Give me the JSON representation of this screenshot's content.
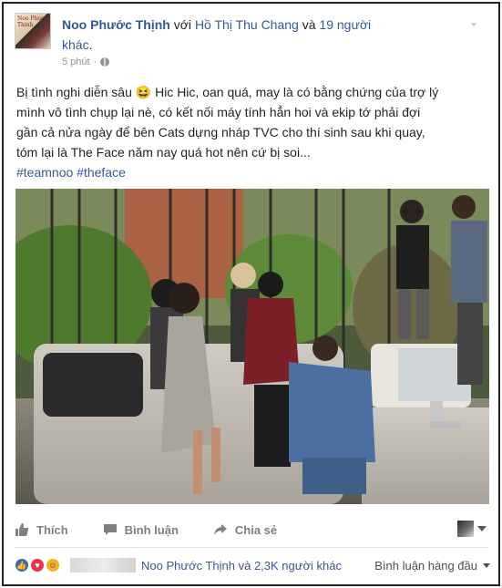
{
  "post": {
    "author": "Noo Phước Thịnh",
    "with_prefix": " với ",
    "tagged_name": "Hồ Thị Thu Chang",
    "and_text": " và ",
    "others": "19 người",
    "others_line2": "khác",
    "others_end": ".",
    "time": "5 phút",
    "dot": "·",
    "avatar_text": "Noo Phuoc Thinh",
    "text_lines": [
      "Bị tình nghi diễn sâu 😆 Hic Hic, oan quá, may là có bằng chứng của trợ lý",
      "mình vô tình chụp lại nè, có kết nối máy tính hẳn hoi và ekip tớ phải đợi",
      "gần cả nửa ngày để bên Cats dựng nháp TVC cho thí sinh sau khi quay,",
      "tóm lại là The Face năm nay quá hot nên cứ bị soi..."
    ],
    "hashtags": [
      "#teamnoo",
      "#theface"
    ]
  },
  "actions": {
    "like": "Thích",
    "comment": "Bình luận",
    "share": "Chia sẻ"
  },
  "reactions": {
    "names": "Noo Phước Thịnh",
    "and_text": " và ",
    "others": "2,3K người khác",
    "sort_label": "Bình luận hàng đầu"
  },
  "colors": {
    "link": "#365899",
    "text": "#1d2129",
    "muted": "#90949c",
    "like": "#4267b2",
    "love": "#e8334a",
    "haha": "#f7b125"
  },
  "icons": {
    "globe": "globe-icon",
    "like": "thumbs-up-icon",
    "comment": "speech-bubble-icon",
    "share": "share-arrow-icon",
    "menu": "chevron-down-icon"
  }
}
